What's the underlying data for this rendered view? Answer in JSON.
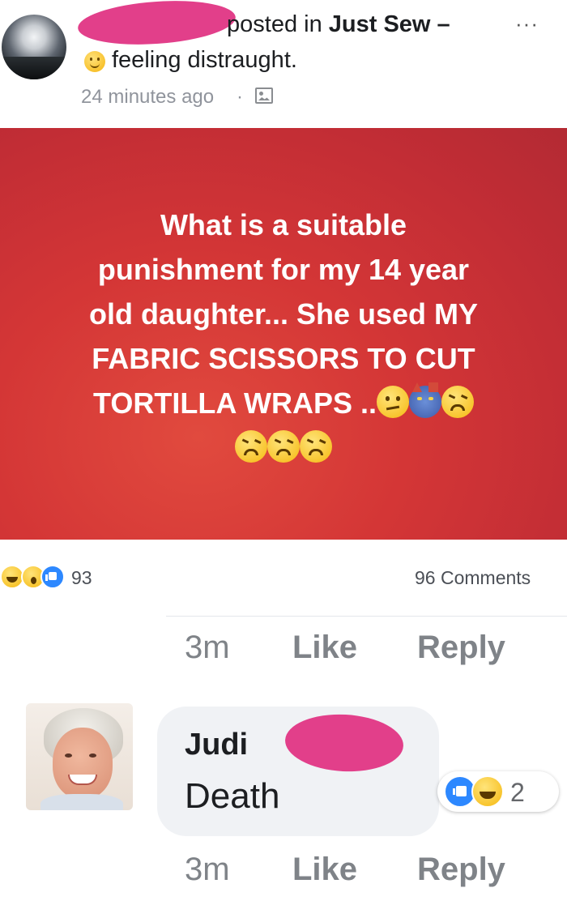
{
  "post": {
    "header": {
      "action_text": "posted in",
      "group_name": "Just Sew –",
      "feeling": "feeling distraught.",
      "timestamp": "24 minutes ago",
      "separator": "·",
      "more": "···"
    },
    "text": [
      "What is a suitable",
      "punishment for my 14 year",
      "old daughter... She used MY",
      "FABRIC SCISSORS TO CUT",
      "TORTILLA WRAPS .."
    ],
    "emojis_line5": [
      "confused-emoji",
      "devil-emoji",
      "angry-emoji"
    ],
    "emojis_line6": [
      "angry-emoji",
      "angry-emoji",
      "angry-emoji"
    ],
    "card_color": "#d43636",
    "reactions": {
      "icons": [
        "haha-icon",
        "wow-icon",
        "like-icon"
      ],
      "count": "93",
      "comments": "96 Comments"
    }
  },
  "comment_actions_top": {
    "time": "3m",
    "like": "Like",
    "reply": "Reply"
  },
  "comment": {
    "author": "Judi",
    "text": "Death",
    "reactions": {
      "icons": [
        "like-icon",
        "haha-icon"
      ],
      "count": "2"
    },
    "actions": {
      "time": "3m",
      "like": "Like",
      "reply": "Reply"
    }
  },
  "colors": {
    "accent": "#2d88ff",
    "redaction": "#e23f8a",
    "muted_text": "#90949c"
  }
}
